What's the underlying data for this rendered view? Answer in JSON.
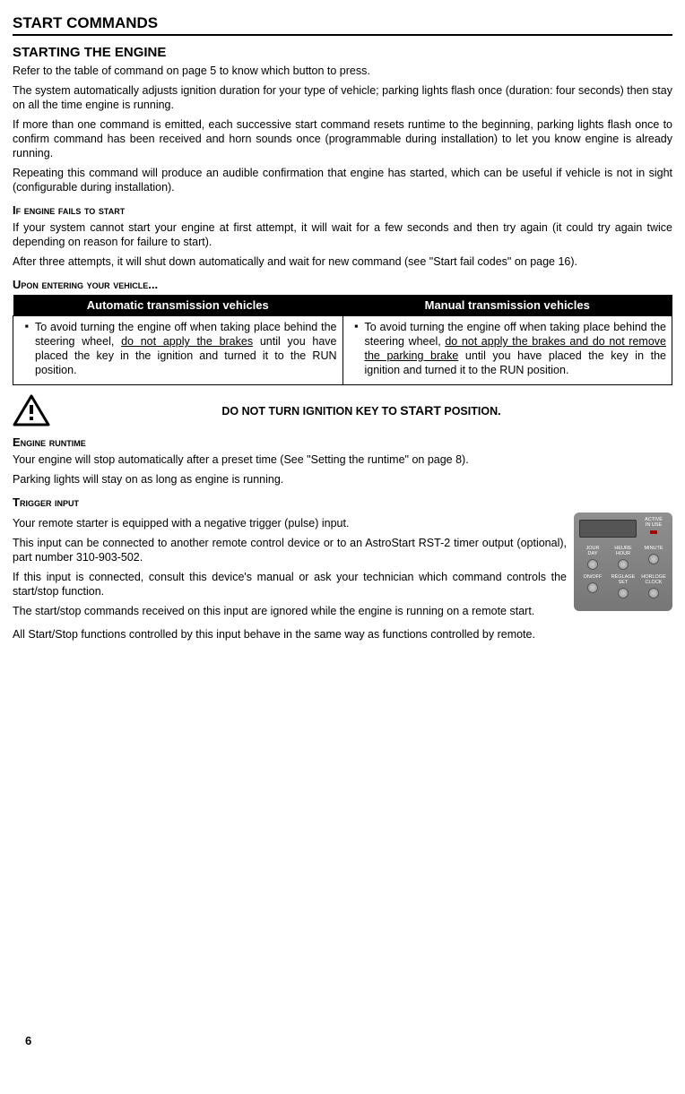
{
  "page_number": "6",
  "title": "START COMMANDS",
  "starting": {
    "heading": "STARTING THE ENGINE",
    "p1": "Refer to the table of command on page 5 to know which button to press.",
    "p2": "The system automatically adjusts ignition duration for your type of vehicle; parking lights flash once (duration: four seconds) then stay on all the time engine is running.",
    "p3": "If more than one command is emitted, each successive start command resets runtime to the beginning, parking lights flash once to confirm command has been received and horn sounds once (programmable during installation) to let you know engine is already running.",
    "p4": "Repeating this command will produce an audible confirmation that engine has started, which can be useful if vehicle is not in sight (configurable during installation)."
  },
  "fails": {
    "heading": "If engine fails to start",
    "p1": "If your system cannot start your engine at first attempt, it will wait for a few seconds and then try again (it could try again twice depending on reason for failure to start).",
    "p2": "After three attempts, it will shut down automatically and wait for new command (see \"Start fail codes\" on page 16)."
  },
  "entering": {
    "heading": "Upon entering your vehicle...",
    "col_auto": "Automatic transmission vehicles",
    "col_manual": "Manual transmission vehicles",
    "auto_pre": "To avoid turning the engine off when taking place behind the steering wheel, ",
    "auto_ul": "do not apply the brakes",
    "auto_post": " until you have placed the key in the ignition and turned it to the RUN position.",
    "manual_pre": "To avoid turning the engine off when taking place behind the steering wheel, ",
    "manual_ul": "do not apply the brakes and do not remove the parking brake",
    "manual_post": " until you have placed the key in the ignition and turned it to the RUN position."
  },
  "warning_pre": "DO NOT TURN IGNITION KEY TO ",
  "warning_big": "START",
  "warning_post": " POSITION.",
  "runtime": {
    "heading": "Engine runtime",
    "p1": "Your engine will stop automatically after a preset time (See \"Setting the runtime\" on page 8).",
    "p2": "Parking lights will stay on as long as engine is running."
  },
  "trigger": {
    "heading": "Trigger input",
    "p1": "Your remote starter is equipped with a negative trigger (pulse) input.",
    "p2": "This input can be connected to another remote control device or to an AstroStart RST-2 timer output (optional), part number 310-903-502.",
    "p3": "If this input is connected, consult this device's manual or ask your technician which command controls the start/stop function.",
    "p4": "The start/stop commands received on this input are ignored while the engine is running on a remote start.",
    "p5": "All Start/Stop functions controlled by this input behave in the same way as functions controlled by remote."
  },
  "timer": {
    "active": "ACTIVÉ\nIN USE",
    "day": "JOUR\nDAY",
    "hour": "HEURE\nHOUR",
    "minute": "MINUTE",
    "onoff": "ON/OFF",
    "set": "RÉGLAGE\nSET",
    "clock": "HORLOGE\nCLOCK"
  }
}
